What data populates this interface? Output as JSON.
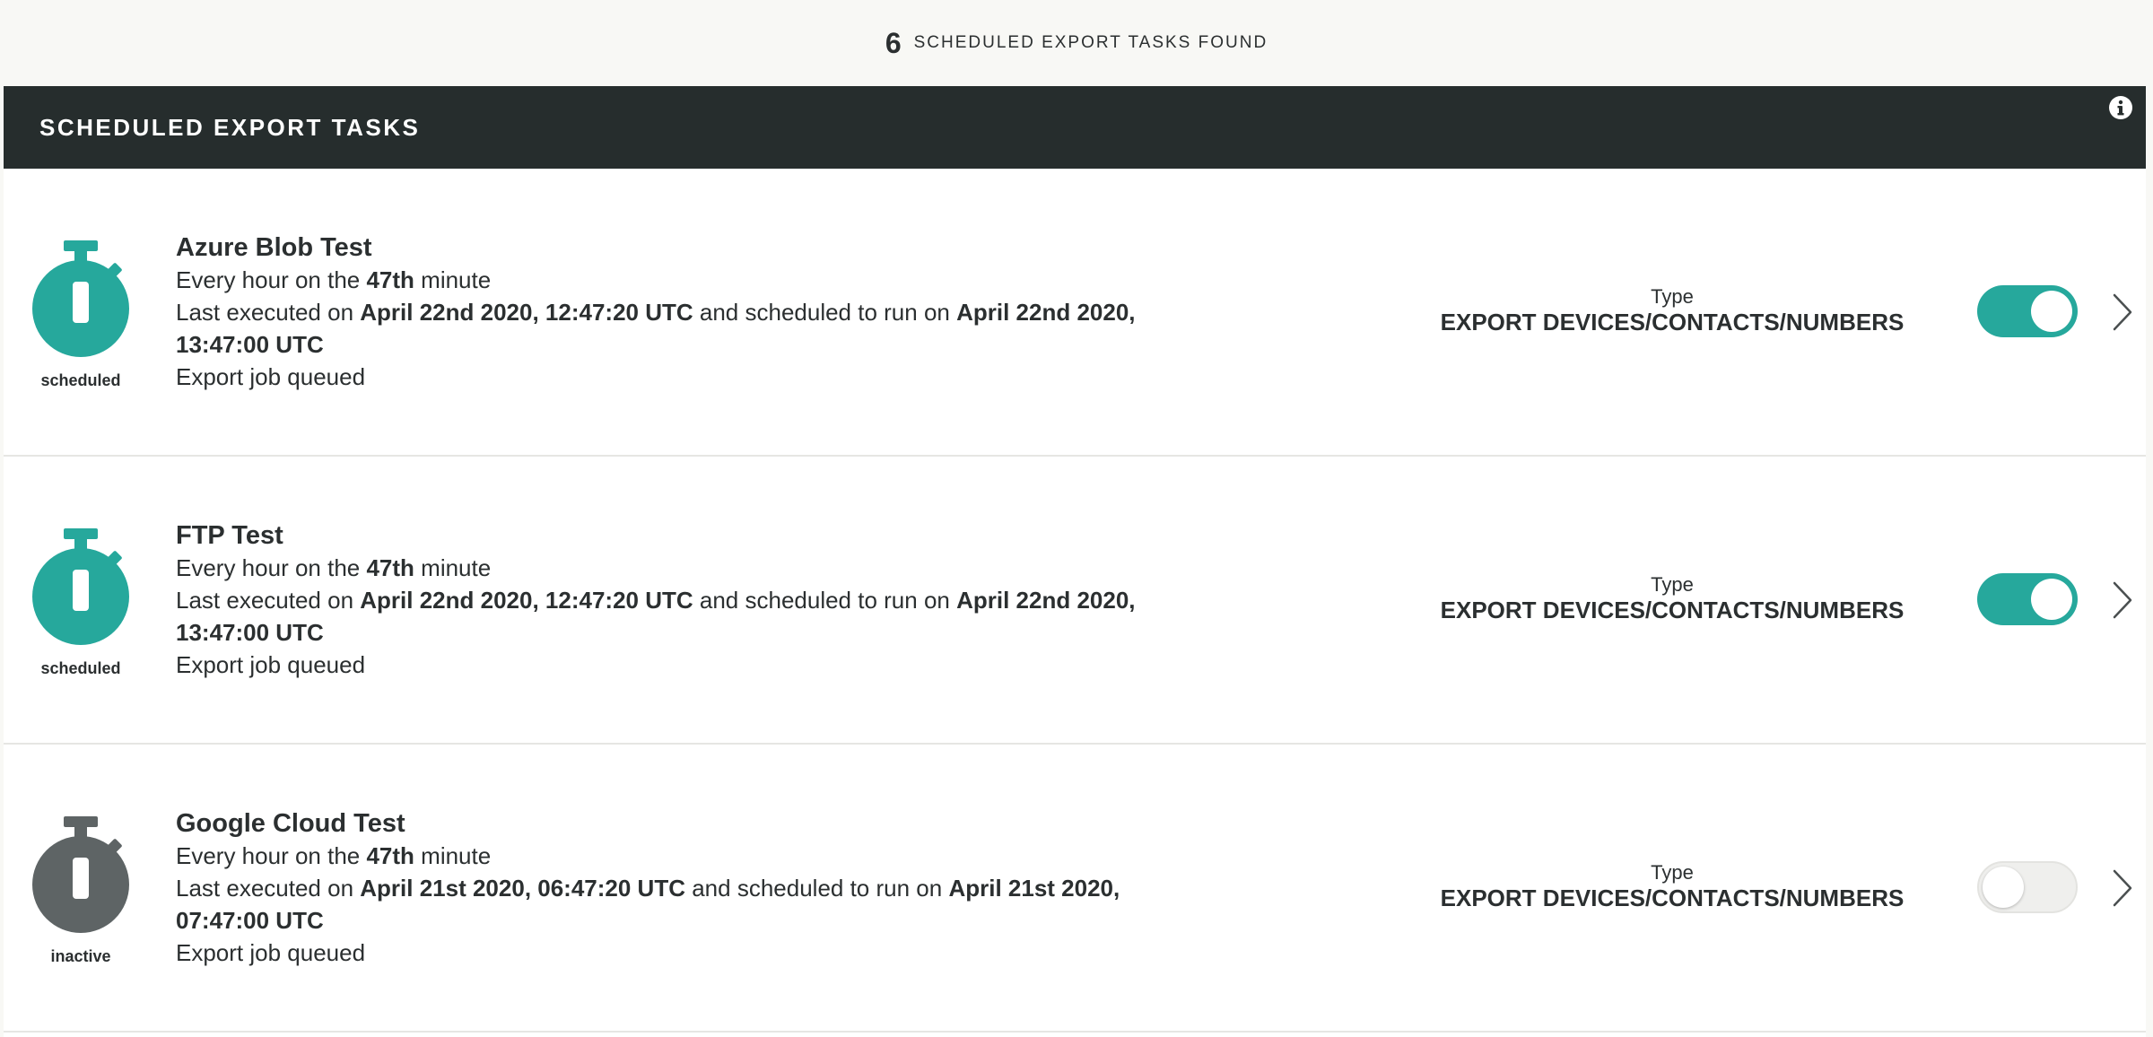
{
  "summary": {
    "count": "6",
    "label": "Scheduled export tasks found"
  },
  "panel": {
    "title": "SCHEDULED EXPORT TASKS",
    "info_icon": "info-icon"
  },
  "colors": {
    "header_bg": "#262d2d",
    "active": "#26a89c",
    "inactive": "#5e6465"
  },
  "tasks": [
    {
      "name": "Azure Blob Test",
      "status": "scheduled",
      "schedule_pre": "Every hour on the ",
      "schedule_bold": "47th",
      "schedule_post": " minute",
      "exec_pre": "Last executed on ",
      "last_executed": "April 22nd 2020, 12:47:20 UTC",
      "exec_mid": " and scheduled to run on ",
      "next_run": "April 22nd 2020, 13:47:00 UTC",
      "job_status": "Export job queued",
      "type_label": "Type",
      "type_value": "EXPORT DEVICES/CONTACTS/NUMBERS",
      "enabled": true
    },
    {
      "name": "FTP Test",
      "status": "scheduled",
      "schedule_pre": "Every hour on the ",
      "schedule_bold": "47th",
      "schedule_post": " minute",
      "exec_pre": "Last executed on ",
      "last_executed": "April 22nd 2020, 12:47:20 UTC",
      "exec_mid": " and scheduled to run on ",
      "next_run": "April 22nd 2020, 13:47:00 UTC",
      "job_status": "Export job queued",
      "type_label": "Type",
      "type_value": "EXPORT DEVICES/CONTACTS/NUMBERS",
      "enabled": true
    },
    {
      "name": "Google Cloud Test",
      "status": "inactive",
      "schedule_pre": "Every hour on the ",
      "schedule_bold": "47th",
      "schedule_post": " minute",
      "exec_pre": "Last executed on ",
      "last_executed": "April 21st 2020, 06:47:20 UTC",
      "exec_mid": " and scheduled to run on ",
      "next_run": "April 21st 2020, 07:47:00 UTC",
      "job_status": "Export job queued",
      "type_label": "Type",
      "type_value": "EXPORT DEVICES/CONTACTS/NUMBERS",
      "enabled": false
    }
  ]
}
